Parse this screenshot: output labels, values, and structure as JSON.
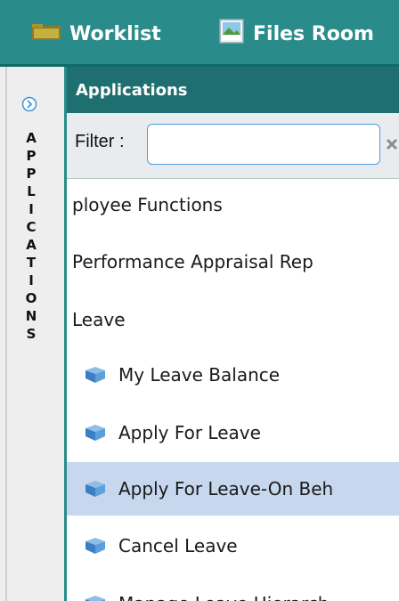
{
  "topbar": {
    "tabs": [
      {
        "label": "Worklist",
        "icon": "folder-icon"
      },
      {
        "label": "Files Room",
        "icon": "image-file-icon"
      }
    ]
  },
  "side_panel": {
    "expand_icon": "chevron-right-circle-icon",
    "vertical_letters": [
      "A",
      "P",
      "P",
      "L",
      "I",
      "C",
      "A",
      "T",
      "I",
      "O",
      "N",
      "S"
    ]
  },
  "applications": {
    "title": "Applications",
    "filter_label": "Filter :",
    "filter_value": "",
    "clear_icon": "clear-x-icon",
    "items": [
      {
        "label": "ployee Functions",
        "level": 0,
        "icon": "",
        "selected": false
      },
      {
        "label": "Performance Appraisal Rep",
        "level": 0,
        "icon": "",
        "selected": false
      },
      {
        "label": "Leave",
        "level": 0,
        "icon": "",
        "selected": false
      },
      {
        "label": "My Leave Balance",
        "level": 1,
        "icon": "application-cube-icon",
        "selected": false
      },
      {
        "label": "Apply For Leave",
        "level": 1,
        "icon": "application-cube-icon",
        "selected": false
      },
      {
        "label": "Apply For Leave-On Beh",
        "level": 1,
        "icon": "application-cube-icon",
        "selected": true
      },
      {
        "label": "Cancel Leave",
        "level": 1,
        "icon": "application-cube-icon",
        "selected": false
      },
      {
        "label": "Manage Leave Hierarch",
        "level": 1,
        "icon": "application-cube-icon",
        "selected": false
      }
    ]
  },
  "colors": {
    "topbar": "#2a8c8a",
    "panel_header": "#1f6f70",
    "selected_row": "#c6d7ee",
    "side_rail": "#eeeeee",
    "filter_bar": "#e9ecef"
  }
}
